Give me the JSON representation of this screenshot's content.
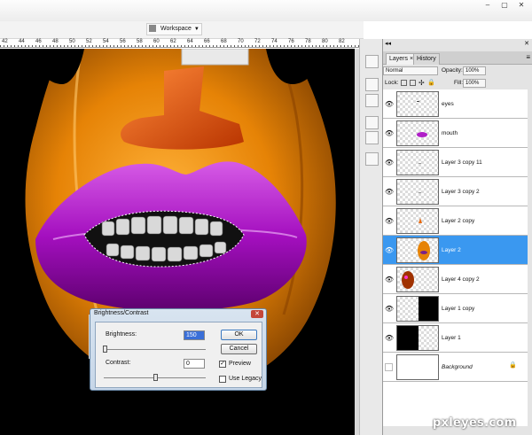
{
  "toolbar": {
    "workspace_label": "Workspace",
    "workspace_caret": "▼"
  },
  "window": {
    "minimize": "–",
    "restore": "▢",
    "close": "✕"
  },
  "ruler": {
    "ticks": [
      "42",
      "44",
      "46",
      "48",
      "50",
      "52",
      "54",
      "56",
      "58",
      "60",
      "62",
      "64",
      "66",
      "68",
      "70",
      "72",
      "74",
      "76",
      "78",
      "80",
      "82"
    ]
  },
  "panel": {
    "tabs": [
      {
        "label": "Layers ×"
      },
      {
        "label": "History"
      }
    ],
    "menu_icon": "≡",
    "collapse_icon": "◂◂",
    "close_icon": "✕",
    "blend_mode": "Normal",
    "opacity_label": "Opacity:",
    "opacity_value": "100%",
    "lock_label": "Lock:",
    "fill_label": "Fill:",
    "fill_value": "100%"
  },
  "layers": [
    {
      "name": "eyes",
      "visible": true
    },
    {
      "name": "mouth",
      "visible": true
    },
    {
      "name": "Layer 3 copy 11",
      "visible": true
    },
    {
      "name": "Layer 3 copy 2",
      "visible": true
    },
    {
      "name": "Layer 2 copy",
      "visible": true
    },
    {
      "name": "Layer 2",
      "visible": true,
      "selected": true
    },
    {
      "name": "Layer 4 copy 2",
      "visible": true
    },
    {
      "name": "Layer 1 copy",
      "visible": true
    },
    {
      "name": "Layer 1",
      "visible": true
    },
    {
      "name": "Background",
      "visible": false,
      "locked": true
    }
  ],
  "dialog": {
    "title": "Brightness/Contrast",
    "close": "✕",
    "brightness_label": "Brightness:",
    "brightness_value": "150",
    "contrast_label": "Contrast:",
    "contrast_value": "0",
    "ok_label": "OK",
    "cancel_label": "Cancel",
    "preview_label": "Preview",
    "preview_checked": true,
    "legacy_label": "Use Legacy",
    "legacy_checked": false
  },
  "watermark": "pxleyes.com",
  "colors": {
    "selection": "#3a98f0",
    "lips": "#b01ec8",
    "skin": "#e88a0a"
  }
}
